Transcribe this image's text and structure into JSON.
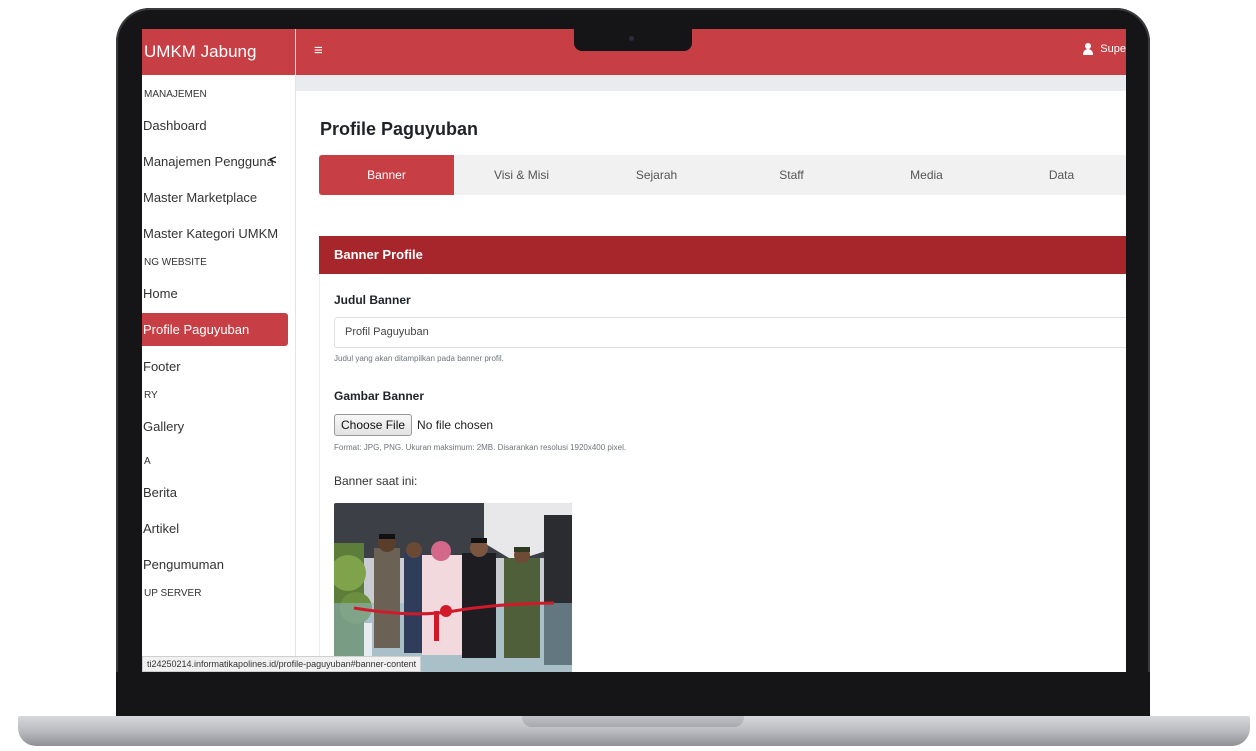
{
  "app": {
    "brand": "UMKM Jabung",
    "user_label": "Supe",
    "hamburger": "≡"
  },
  "sidebar": {
    "sections": [
      {
        "title": "MANAJEMEN",
        "items": [
          "Dashboard",
          "Manajemen Pengguna",
          "Master Marketplace",
          "Master Kategori UMKM"
        ]
      },
      {
        "title": "NG WEBSITE",
        "items": [
          "Home",
          "Profile Paguyuban",
          "Footer"
        ]
      },
      {
        "title": "RY",
        "items": [
          "Gallery"
        ]
      },
      {
        "title": "A",
        "items": [
          "Berita",
          "Artikel",
          "Pengumuman"
        ]
      },
      {
        "title": "UP SERVER",
        "items": []
      }
    ],
    "active_item": "Profile Paguyuban",
    "chevron": "<"
  },
  "page": {
    "title": "Profile Paguyuban",
    "tabs": [
      "Banner",
      "Visi & Misi",
      "Sejarah",
      "Staff",
      "Media",
      "Data"
    ],
    "active_tab": "Banner"
  },
  "card": {
    "header": "Banner Profile",
    "judul_label": "Judul Banner",
    "judul_value": "Profil Paguyuban",
    "judul_hint": "Judul yang akan ditampilkan pada banner profil.",
    "gambar_label": "Gambar Banner",
    "file_button": "Choose File",
    "file_status": "No file chosen",
    "gambar_hint": "Format: JPG, PNG. Ukuran maksimum: 2MB. Disarankan resolusi 1920x400 pixel.",
    "current_label": "Banner saat ini:"
  },
  "status_url": "ti24250214.informatikapolines.id/profile-paguyuban#banner-content",
  "colors": {
    "primary": "#c73f45",
    "card_header": "#a7262c"
  }
}
